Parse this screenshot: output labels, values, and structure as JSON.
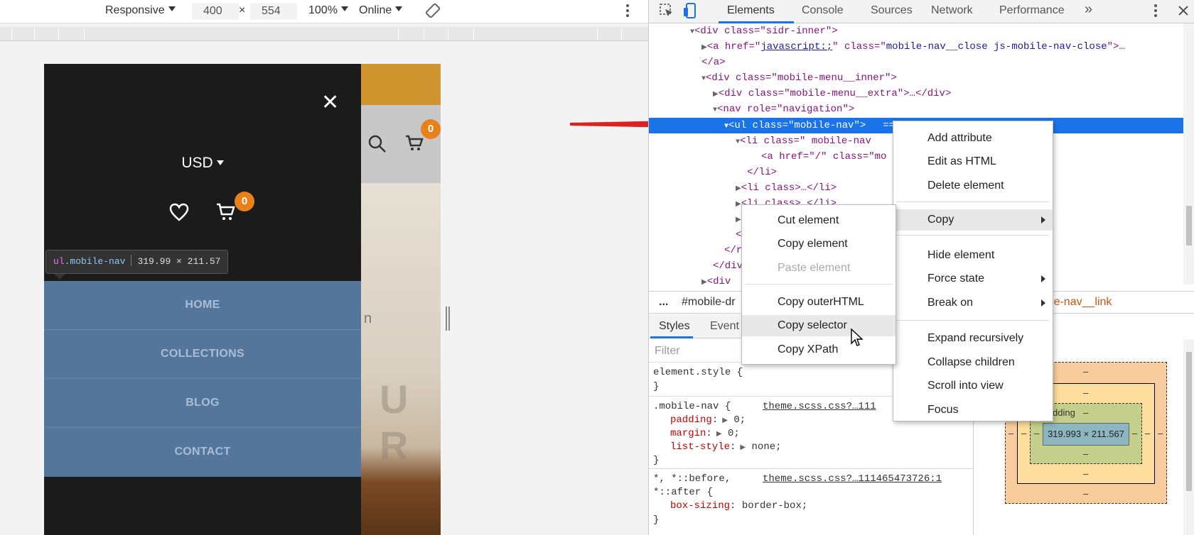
{
  "device_toolbar": {
    "device": "Responsive",
    "width": "400",
    "x": "×",
    "height": "554",
    "zoom": "100%",
    "throttle": "Online"
  },
  "site": {
    "partial_text": "n",
    "watermark": "U R",
    "cart_count": "0"
  },
  "drawer": {
    "close": "✕",
    "currency": "USD",
    "cart_count": "0",
    "tooltip_tag": "ul",
    "tooltip_class": ".mobile-nav",
    "tooltip_size": "319.99 × 211.57",
    "nav_items": [
      "HOME",
      "COLLECTIONS",
      "BLOG",
      "CONTACT"
    ]
  },
  "devtools": {
    "tabs": [
      "Elements",
      "Console",
      "Sources",
      "Network",
      "Performance"
    ],
    "more": "»",
    "elements": {
      "l1": "<div class=\"sidr-inner\">",
      "l2a": "<a href=\"",
      "l2link": "javascript:;",
      "l2b": "\" class=\"",
      "l2val": "mobile-nav__close js-mobile-nav-close",
      "l2c": "\">…",
      "l3": "</a>",
      "l4": "<div class=\"mobile-menu__inner\">",
      "l5": "<div class=\"mobile-menu__extra\">…</div>",
      "l6": "<nav role=\"navigation\">",
      "l7": "<ul class=\"mobile-nav\">",
      "l7tail": "== $0",
      "l8": "<li class=\" mobile-nav",
      "l9": "<a href=\"/\" class=\"mo",
      "l10": "</li>",
      "l11": "<li class>…</li>",
      "l12": "<li class>…</li>",
      "l13": "<",
      "l14": "<",
      "l15": "</r",
      "l16": "</div",
      "l17": "<div"
    },
    "breadcrumb": {
      "dots": "...",
      "first": "#mobile-dr",
      "last1": "ve",
      "last2": "a.mobile-nav__link"
    },
    "styles_tabs": [
      "Styles",
      "Event"
    ],
    "filter_placeholder": "Filter",
    "styles": {
      "element_style": "element.style {",
      "close": "}",
      "mobile_nav_selector": ".mobile-nav {",
      "mobile_nav_src": "theme.scss.css?…111",
      "padding": "padding",
      "padding_val": "0;",
      "margin": "margin",
      "margin_val": "0;",
      "list_style": "list-style",
      "list_style_val": "none;",
      "universal_selector": "*, *::before,",
      "universal_selector2": "*::after {",
      "universal_src": "theme.scss.css?…111465473726:1",
      "box_sizing": "box-sizing",
      "box_sizing_val": "border-box;"
    },
    "box_model": {
      "dash": "–",
      "padding_label": "dding",
      "content": "319.993 × 211.567"
    }
  },
  "context_menu_main": {
    "items": [
      "Add attribute",
      "Edit as HTML",
      "Delete element",
      "Copy",
      "Hide element",
      "Force state",
      "Break on",
      "Expand recursively",
      "Collapse children",
      "Scroll into view",
      "Focus"
    ]
  },
  "context_menu_copy": {
    "items": [
      "Cut element",
      "Copy element",
      "Paste element",
      "Copy outerHTML",
      "Copy selector",
      "Copy XPath"
    ]
  },
  "colors": {
    "accent": "#1a73e8",
    "nav_bg": "#54769a",
    "badge": "#e8811a",
    "arrow": "#e02020"
  }
}
